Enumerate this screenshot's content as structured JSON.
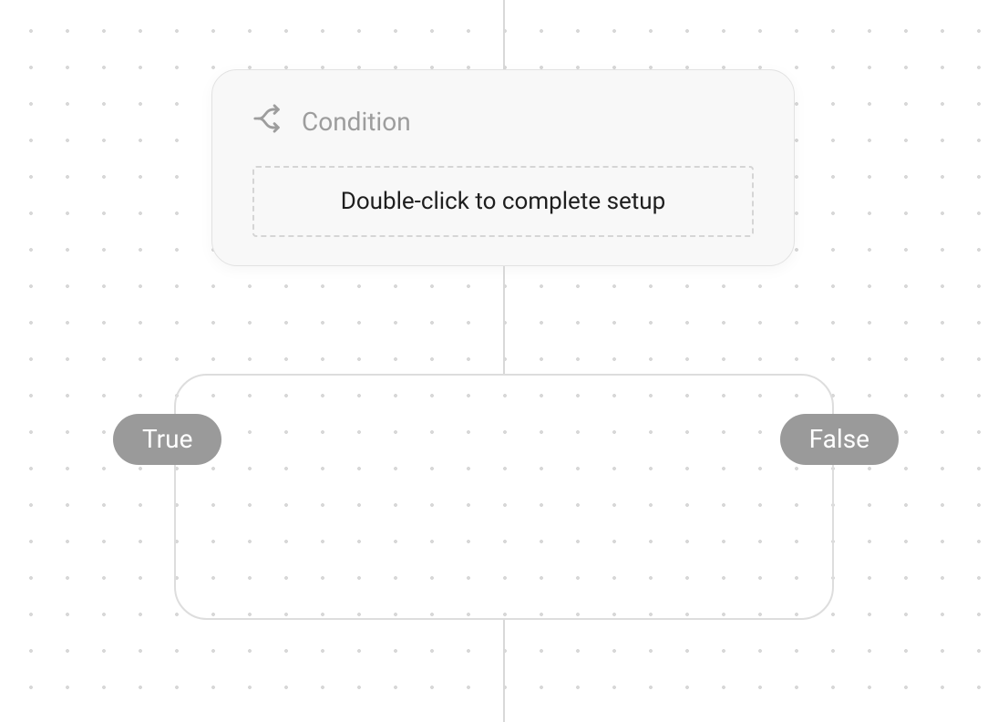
{
  "condition": {
    "title": "Condition",
    "placeholder": "Double-click to complete setup"
  },
  "branches": {
    "true_label": "True",
    "false_label": "False"
  }
}
